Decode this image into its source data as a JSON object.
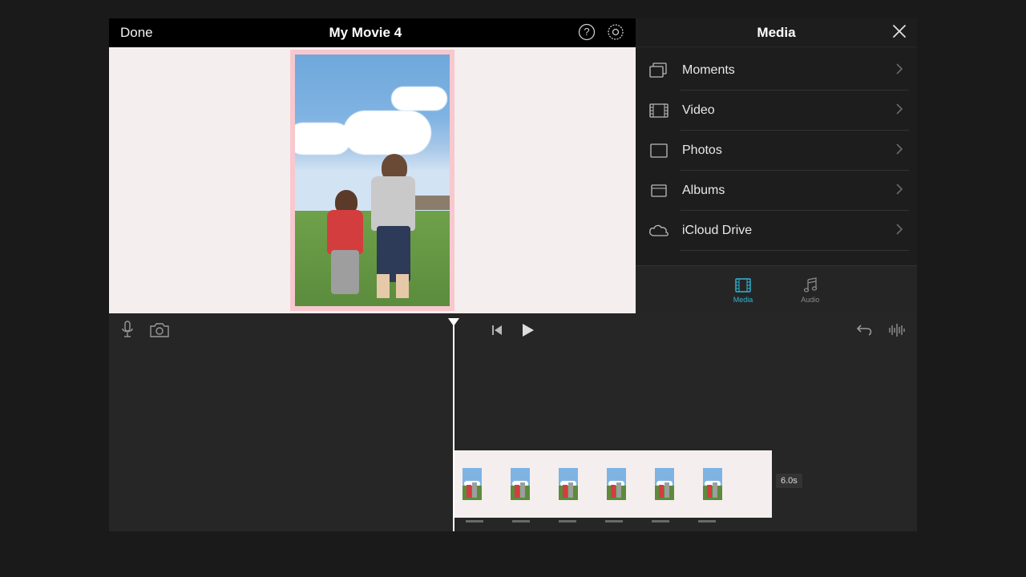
{
  "header": {
    "done_label": "Done",
    "title": "My Movie 4"
  },
  "media": {
    "panel_title": "Media",
    "items": [
      {
        "label": "Moments",
        "icon": "moments"
      },
      {
        "label": "Video",
        "icon": "video"
      },
      {
        "label": "Photos",
        "icon": "photos"
      },
      {
        "label": "Albums",
        "icon": "albums"
      },
      {
        "label": "iCloud Drive",
        "icon": "icloud"
      }
    ],
    "tabs": {
      "media_label": "Media",
      "audio_label": "Audio"
    }
  },
  "timeline": {
    "clip_duration": "6.0s"
  }
}
